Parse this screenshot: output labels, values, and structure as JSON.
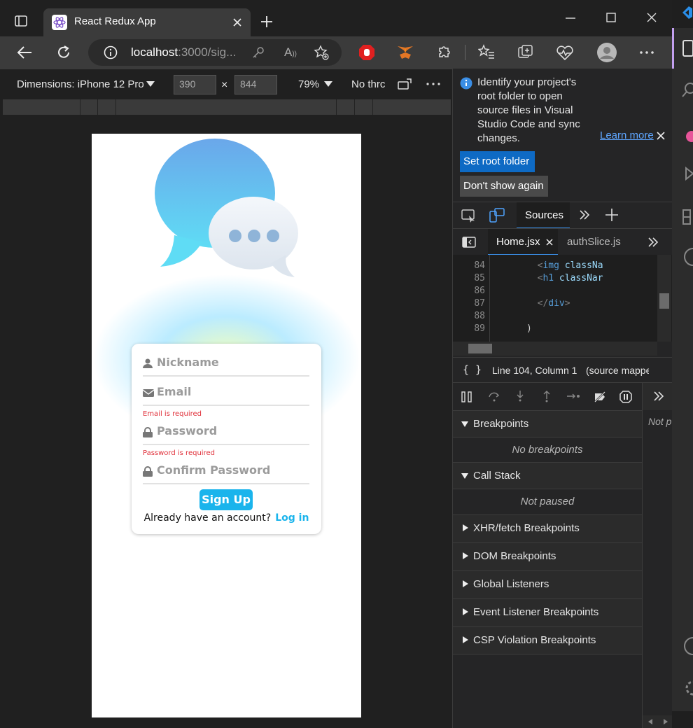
{
  "browser": {
    "tab_title": "React Redux App",
    "url_host": "localhost",
    "url_rest": ":3000/sig..."
  },
  "device_toolbar": {
    "dimensions_label": "Dimensions: iPhone 12 Pro",
    "width": "390",
    "height": "844",
    "times": "×",
    "zoom": "79%",
    "throttle": "No thrc"
  },
  "signup_form": {
    "nickname_label": "Nickname",
    "email_label": "Email",
    "email_error": "Email is required",
    "password_label": "Password",
    "password_error": "Password is required",
    "confirm_label": "Confirm Password",
    "submit_label": "Sign Up",
    "login_prompt": "Already have an account?",
    "login_link": "Log in"
  },
  "devtools": {
    "banner_text": "Identify your project's root folder to open source files in Visual Studio Code and sync changes.",
    "learn_more": "Learn more",
    "set_root_label": "Set root folder",
    "dont_show_label": "Don't show again",
    "sources_tab": "Sources",
    "file_tabs": [
      "Home.jsx",
      "authSlice.js"
    ],
    "code_lines": [
      {
        "n": "84",
        "indent": "        ",
        "open": "<",
        "tag": "img",
        "attr": " classNa"
      },
      {
        "n": "85",
        "indent": "        ",
        "open": "<",
        "tag": "h1",
        "attr": " classNar"
      },
      {
        "n": "86",
        "indent": "",
        "open": "",
        "tag": "",
        "attr": ""
      },
      {
        "n": "87",
        "indent": "        ",
        "open": "</",
        "tag": "div",
        "attr": ">"
      },
      {
        "n": "88",
        "indent": "",
        "open": "",
        "tag": "",
        "attr": ""
      },
      {
        "n": "89",
        "indent": "      ",
        "open": ")",
        "tag": "",
        "attr": ""
      }
    ],
    "status_position": "Line 104, Column 1",
    "status_source": "(source mapped from",
    "braces": "{ }",
    "breakpoints_title": "Breakpoints",
    "no_breakpoints": "No breakpoints",
    "callstack_title": "Call Stack",
    "not_paused": "Not paused",
    "side_not_paused": "Not p",
    "collapsed_sections": [
      "XHR/fetch Breakpoints",
      "DOM Breakpoints",
      "Global Listeners",
      "Event Listener Breakpoints",
      "CSP Violation Breakpoints"
    ]
  },
  "colors": {
    "accent": "#1ab4ec",
    "error": "#e0303a",
    "devtools_blue": "#0e6ac4"
  }
}
